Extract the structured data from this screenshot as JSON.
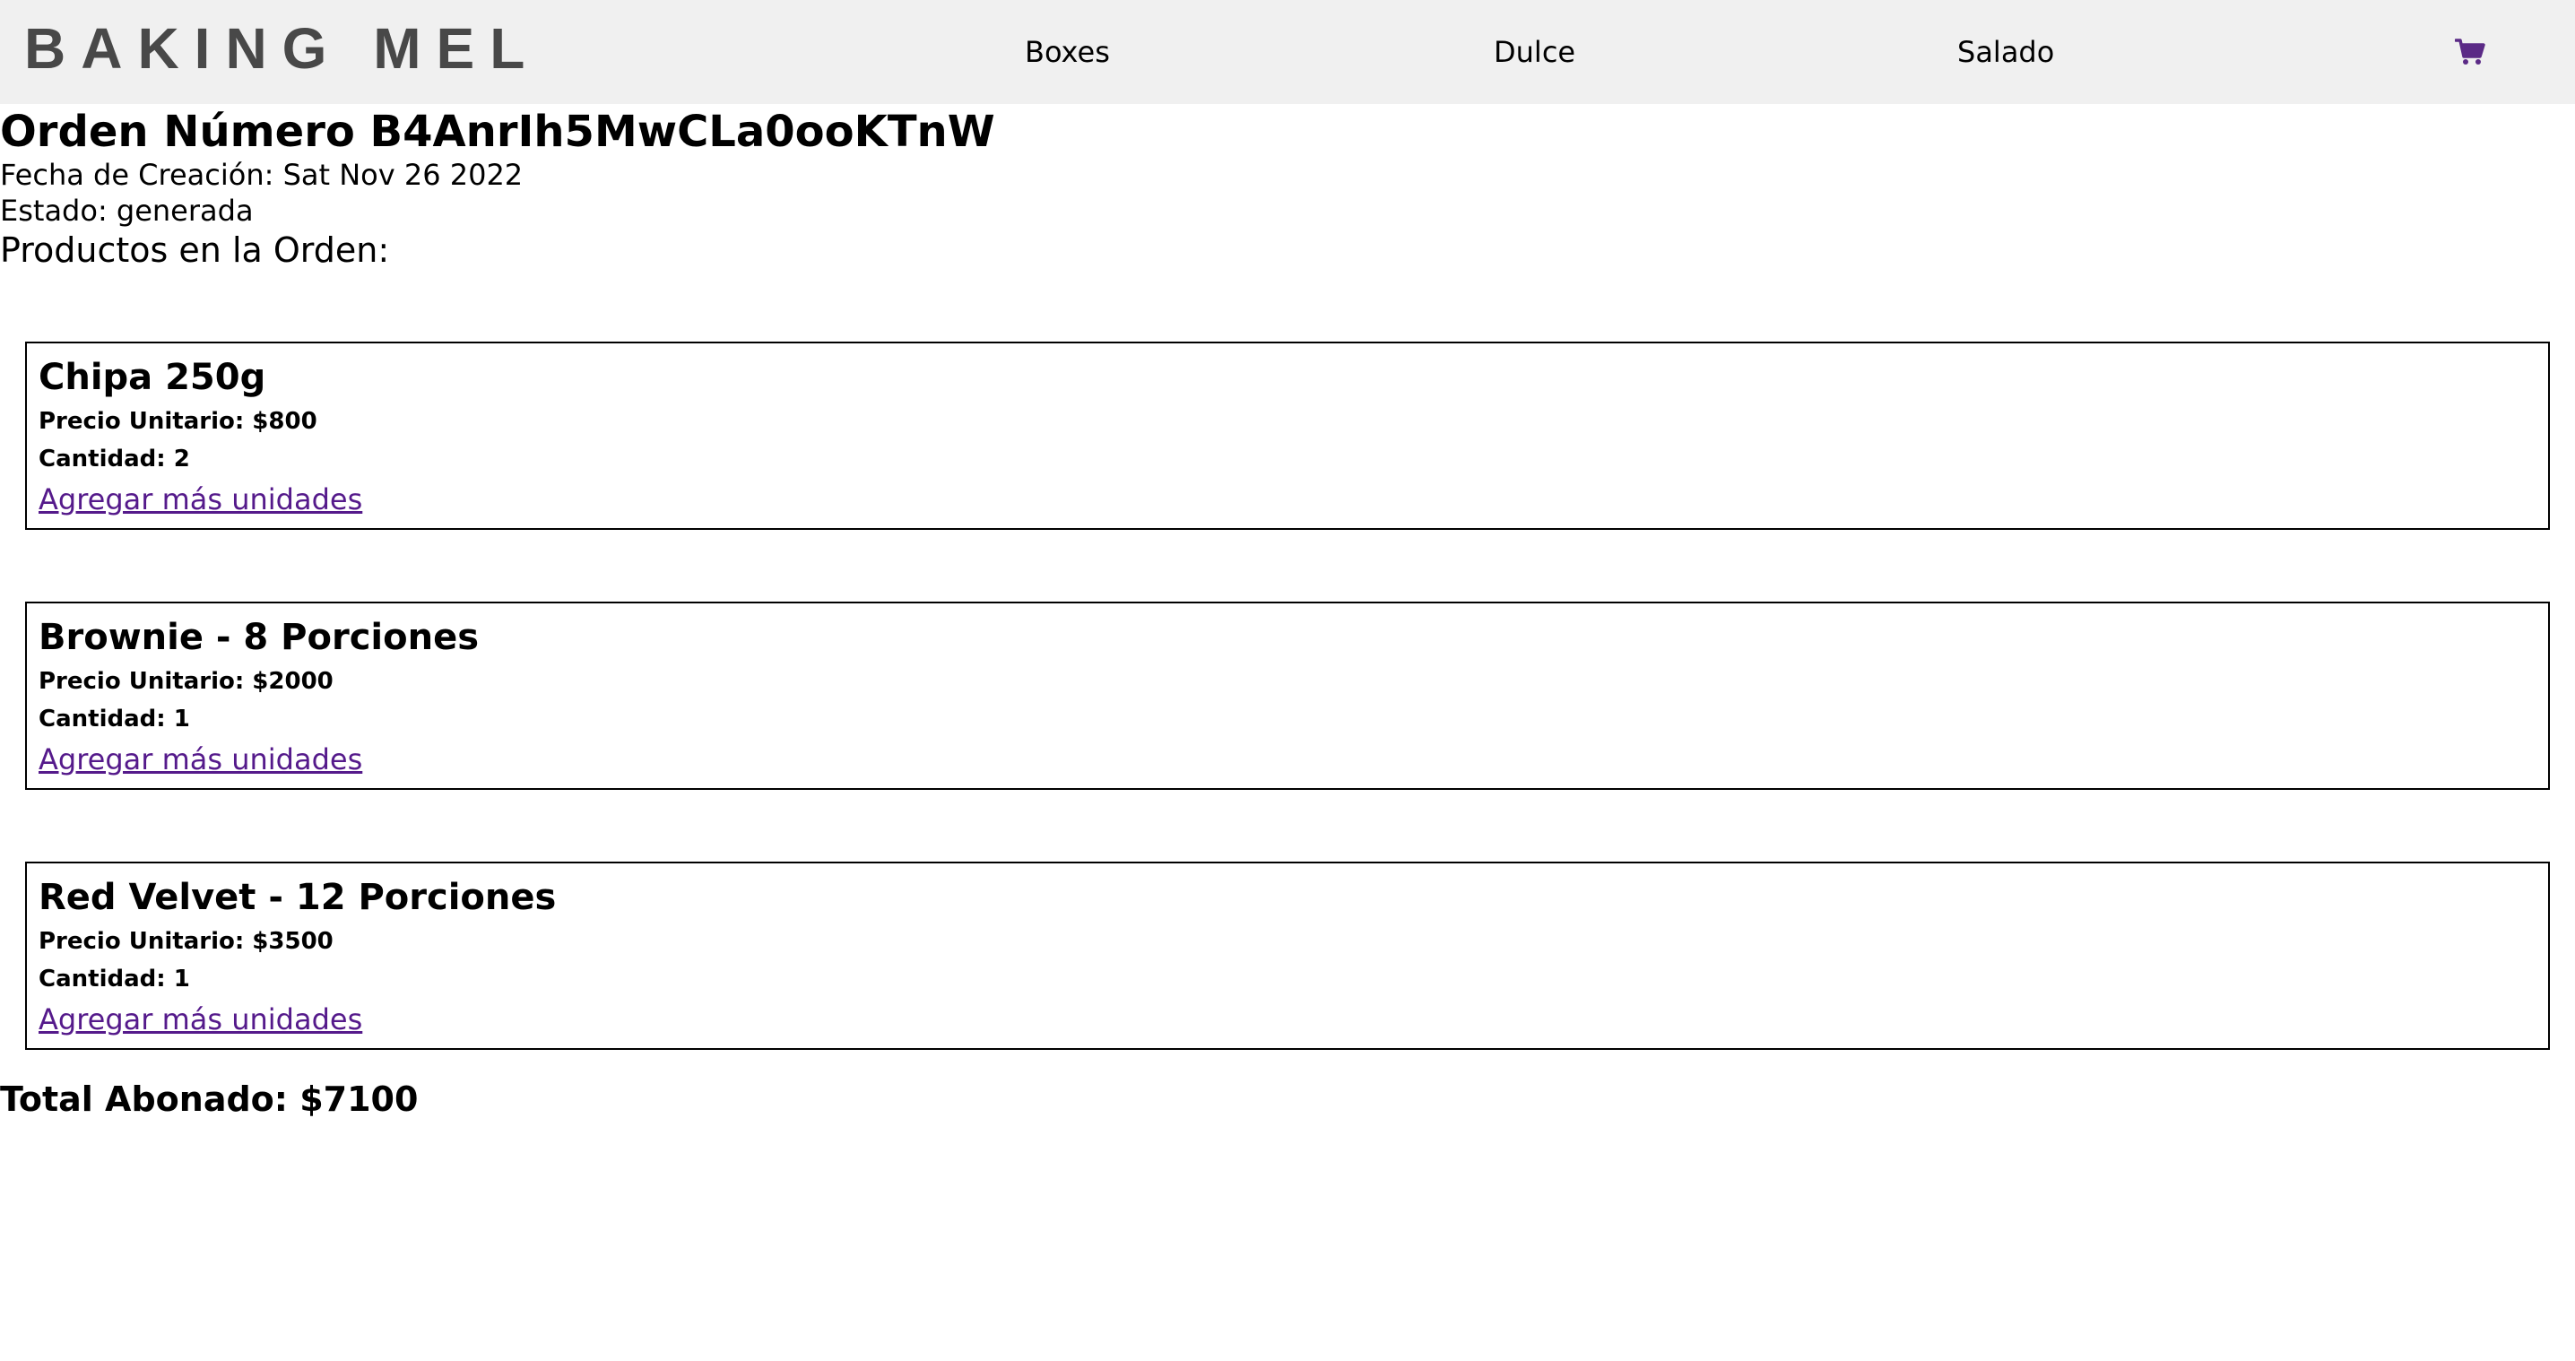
{
  "navbar": {
    "brand": "BAKING MEL",
    "links": [
      {
        "label": "Boxes"
      },
      {
        "label": "Dulce"
      },
      {
        "label": "Salado"
      }
    ],
    "cart_icon": "shopping-cart-icon",
    "cart_color": "#5b2a86"
  },
  "order": {
    "title": "Orden Número B4AnrIh5MwCLa0ooKTnW",
    "created": "Fecha de Creación: Sat Nov 26 2022",
    "status": "Estado: generada",
    "products_heading": "Productos en la Orden:",
    "items": [
      {
        "name": "Chipa 250g",
        "unit_price": "Precio Unitario: $800",
        "quantity": "Cantidad: 2",
        "add_more": "Agregar más unidades"
      },
      {
        "name": "Brownie - 8 Porciones",
        "unit_price": "Precio Unitario: $2000",
        "quantity": "Cantidad: 1",
        "add_more": "Agregar más unidades"
      },
      {
        "name": "Red Velvet - 12 Porciones",
        "unit_price": "Precio Unitario: $3500",
        "quantity": "Cantidad: 1",
        "add_more": "Agregar más unidades"
      }
    ],
    "total": "Total Abonado: $7100"
  },
  "colors": {
    "navbar_bg": "#f0f0f0",
    "brand": "#484848",
    "link_visited": "#551a8b"
  }
}
